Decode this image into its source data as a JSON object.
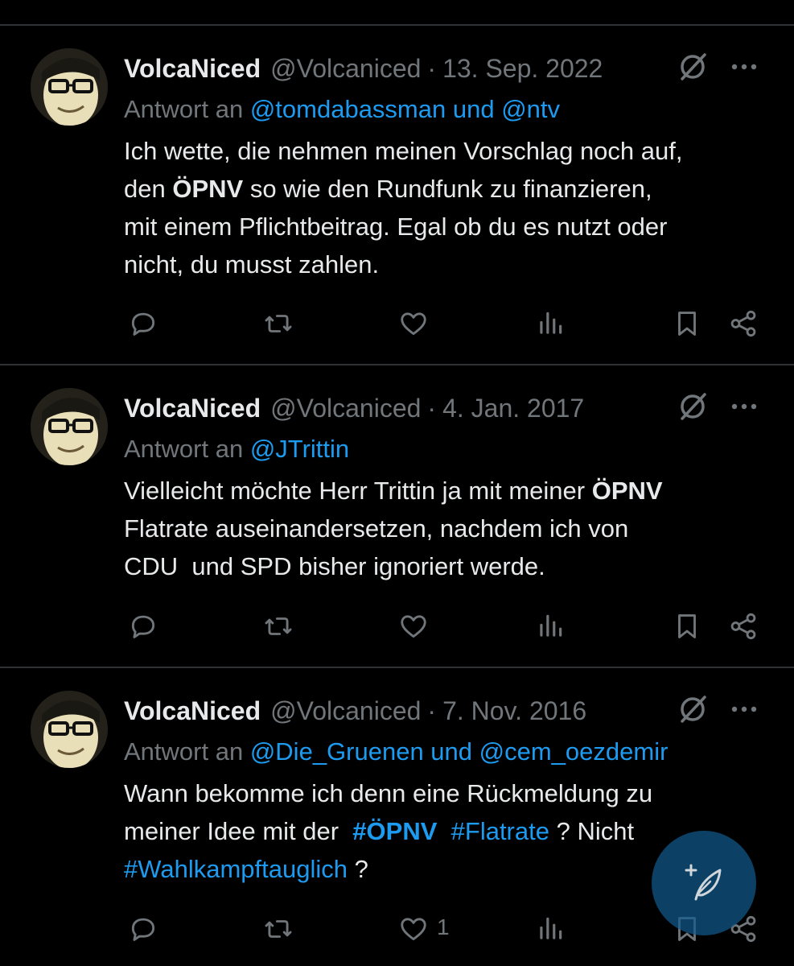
{
  "tweets": [
    {
      "name": "VolcaNiced",
      "handle": "@Volcaniced",
      "separator": "·",
      "date": "13. Sep. 2022",
      "reply_prefix": "Antwort an",
      "reply_to": "@tomdabassman und @ntv",
      "text_parts": [
        "Ich wette, die nehmen meinen Vorschlag noch auf,",
        "den ",
        "ÖPNV",
        " so wie den Rundfunk zu finanzieren,",
        "mit einem Pflichtbeitrag. Egal ob du es nutzt oder",
        "nicht, du musst zahlen."
      ],
      "like_count": ""
    },
    {
      "name": "VolcaNiced",
      "handle": "@Volcaniced",
      "separator": "·",
      "date": "4. Jan. 2017",
      "reply_prefix": "Antwort an",
      "reply_to": "@JTrittin",
      "text_parts": [
        "Vielleicht möchte Herr Trittin ja mit meiner ",
        "ÖPNV",
        "Flatrate auseinandersetzen, nachdem ich von",
        "CDU  und SPD bisher ignoriert werde."
      ],
      "like_count": ""
    },
    {
      "name": "VolcaNiced",
      "handle": "@Volcaniced",
      "separator": "·",
      "date": "7. Nov. 2016",
      "reply_prefix": "Antwort an",
      "reply_to": "@Die_Gruenen und @cem_oezdemir",
      "text_parts": [
        "Wann bekomme ich denn eine Rückmeldung zu",
        "meiner Idee mit der  ",
        "#ÖPNV",
        "#Flatrate",
        " ? Nicht",
        "#Wahlkampftauglich",
        " ?"
      ],
      "like_count": "1"
    }
  ],
  "icons": {
    "reply": "reply-icon",
    "retweet": "retweet-icon",
    "like": "heart-icon",
    "views": "views-icon",
    "bookmark": "bookmark-icon",
    "share": "share-icon",
    "grok": "grok-icon",
    "more": "more-icon",
    "compose": "compose-icon"
  },
  "colors": {
    "background": "#000000",
    "text": "#e7e9ea",
    "muted": "#71767b",
    "link": "#1d9bf0",
    "divider": "#2f3336",
    "fab": "#105a8c"
  }
}
